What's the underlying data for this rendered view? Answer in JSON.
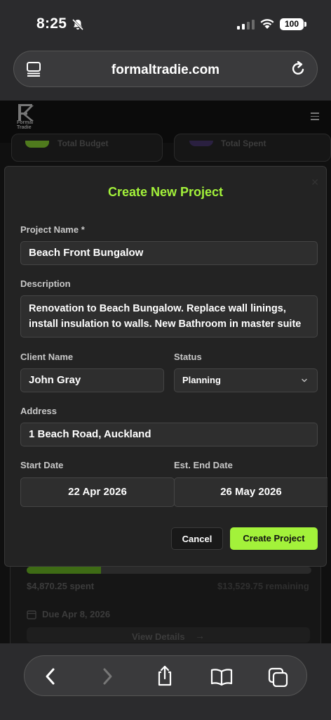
{
  "status_bar": {
    "time": "8:25",
    "battery": "100"
  },
  "browser": {
    "url": "formaltradie.com"
  },
  "site": {
    "logo_text_line1": "Formal",
    "logo_text_line2": "Tradie"
  },
  "background": {
    "total_budget_label": "Total Budget",
    "total_spent_label": "Total Spent",
    "spent": "$4,870.25 spent",
    "remaining": "$13,529.75 remaining",
    "due": "Due Apr 8, 2026",
    "view_details": "View Details",
    "progress_fraction": 0.26
  },
  "modal": {
    "title": "Create New Project",
    "project_name_label": "Project Name *",
    "project_name_value": "Beach Front Bungalow",
    "description_label": "Description",
    "description_value": "Renovation to Beach Bungalow. Replace wall linings, install insulation to walls. New Bathroom in master suite",
    "client_name_label": "Client Name",
    "client_name_value": "John Gray",
    "status_label": "Status",
    "status_value": "Planning",
    "address_label": "Address",
    "address_value": "1 Beach Road, Auckland",
    "start_date_label": "Start Date",
    "start_date_value": "22 Apr 2026",
    "end_date_label": "Est. End Date",
    "end_date_value": "26 May 2026",
    "cancel_label": "Cancel",
    "create_label": "Create Project"
  },
  "colors": {
    "accent": "#a3f23a",
    "modal_bg": "#232323",
    "field_bg": "#2e2e2e"
  }
}
